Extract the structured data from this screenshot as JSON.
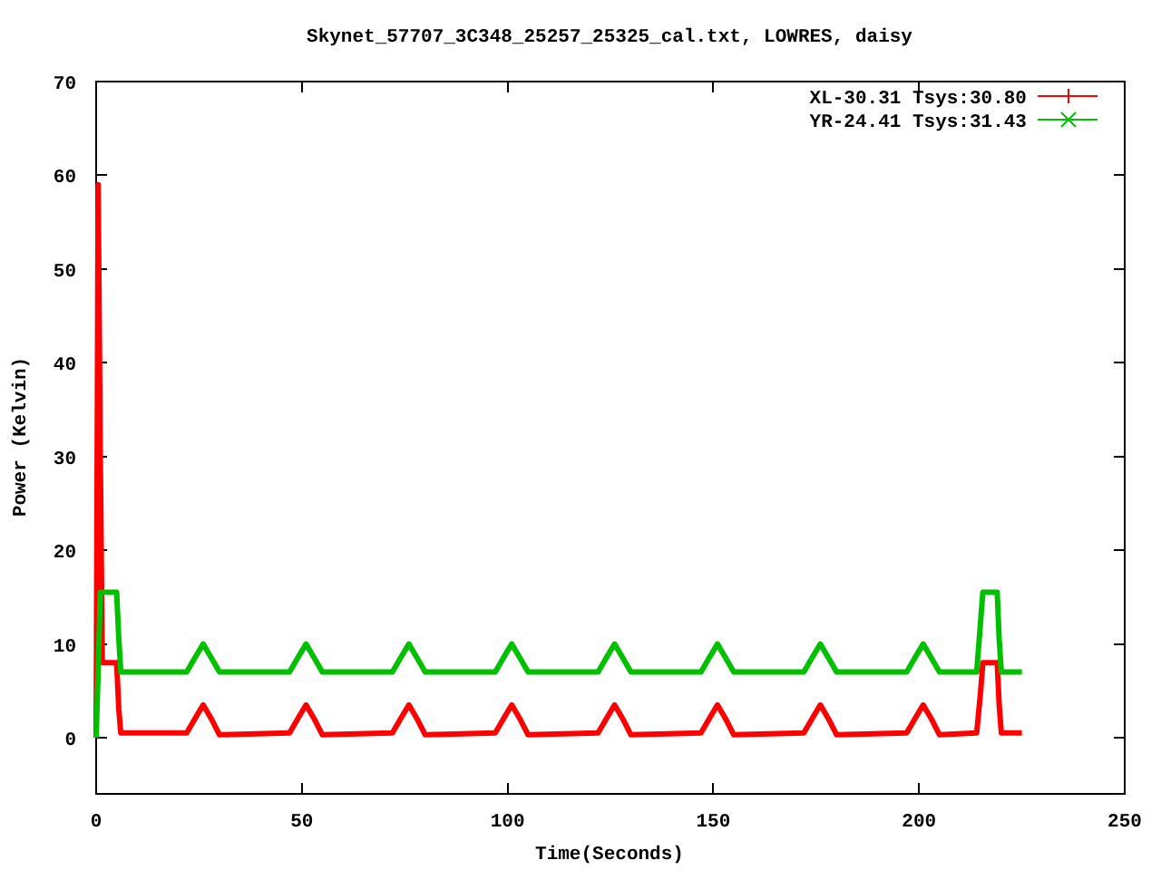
{
  "chart": {
    "chart_data": {
      "type": "line",
      "title": "Skynet_57707_3C348_25257_25325_cal.txt, LOWRES, daisy",
      "xlabel": "Time(Seconds)",
      "ylabel": "Power (Kelvin)",
      "x": [
        0,
        0.5,
        1,
        1.5,
        5,
        5.5,
        6,
        22,
        24,
        26,
        28,
        30,
        47,
        49,
        51,
        53,
        55,
        72,
        74,
        76,
        78,
        80,
        97,
        99,
        101,
        103,
        105,
        122,
        124,
        126,
        128,
        130,
        147,
        149,
        151,
        153,
        155,
        172,
        174,
        176,
        178,
        180,
        197,
        199,
        201,
        203,
        205,
        214,
        215,
        215.5,
        219,
        219.5,
        220,
        225
      ],
      "legend": true,
      "xlim": [
        0,
        250
      ],
      "ylim": [
        -6,
        70
      ],
      "xticks": [
        0,
        50,
        100,
        150,
        200,
        250
      ],
      "yticks": [
        0,
        10,
        20,
        30,
        40,
        50,
        60,
        70
      ],
      "series": [
        {
          "name": "XL-30.31 Tsys:30.80",
          "color": "#ff0000",
          "values": [
            0,
            59,
            30,
            8,
            8,
            3,
            0.5,
            0.5,
            2,
            3.5,
            2,
            0.3,
            0.5,
            2,
            3.5,
            2,
            0.3,
            0.5,
            2,
            3.5,
            2,
            0.3,
            0.5,
            2,
            3.5,
            2,
            0.3,
            0.5,
            2,
            3.5,
            2,
            0.3,
            0.5,
            2,
            3.5,
            2,
            0.3,
            0.5,
            2,
            3.5,
            2,
            0.3,
            0.5,
            2,
            3.5,
            2,
            0.3,
            0.5,
            5,
            8,
            8,
            3.5,
            0.5,
            0.5
          ]
        },
        {
          "name": "YR-24.41 Tsys:31.43",
          "color": "#00c000",
          "values": [
            0,
            7,
            15.5,
            15.5,
            15.5,
            10.5,
            7,
            7,
            8.5,
            10,
            8.5,
            7,
            7,
            8.5,
            10,
            8.5,
            7,
            7,
            8.5,
            10,
            8.5,
            7,
            7,
            8.5,
            10,
            8.5,
            7,
            7,
            8.5,
            10,
            8.5,
            7,
            7,
            8.5,
            10,
            8.5,
            7,
            7,
            8.5,
            10,
            8.5,
            7,
            7,
            8.5,
            10,
            8.5,
            7,
            7,
            12.5,
            15.5,
            15.5,
            10.5,
            7,
            7
          ]
        }
      ]
    }
  }
}
